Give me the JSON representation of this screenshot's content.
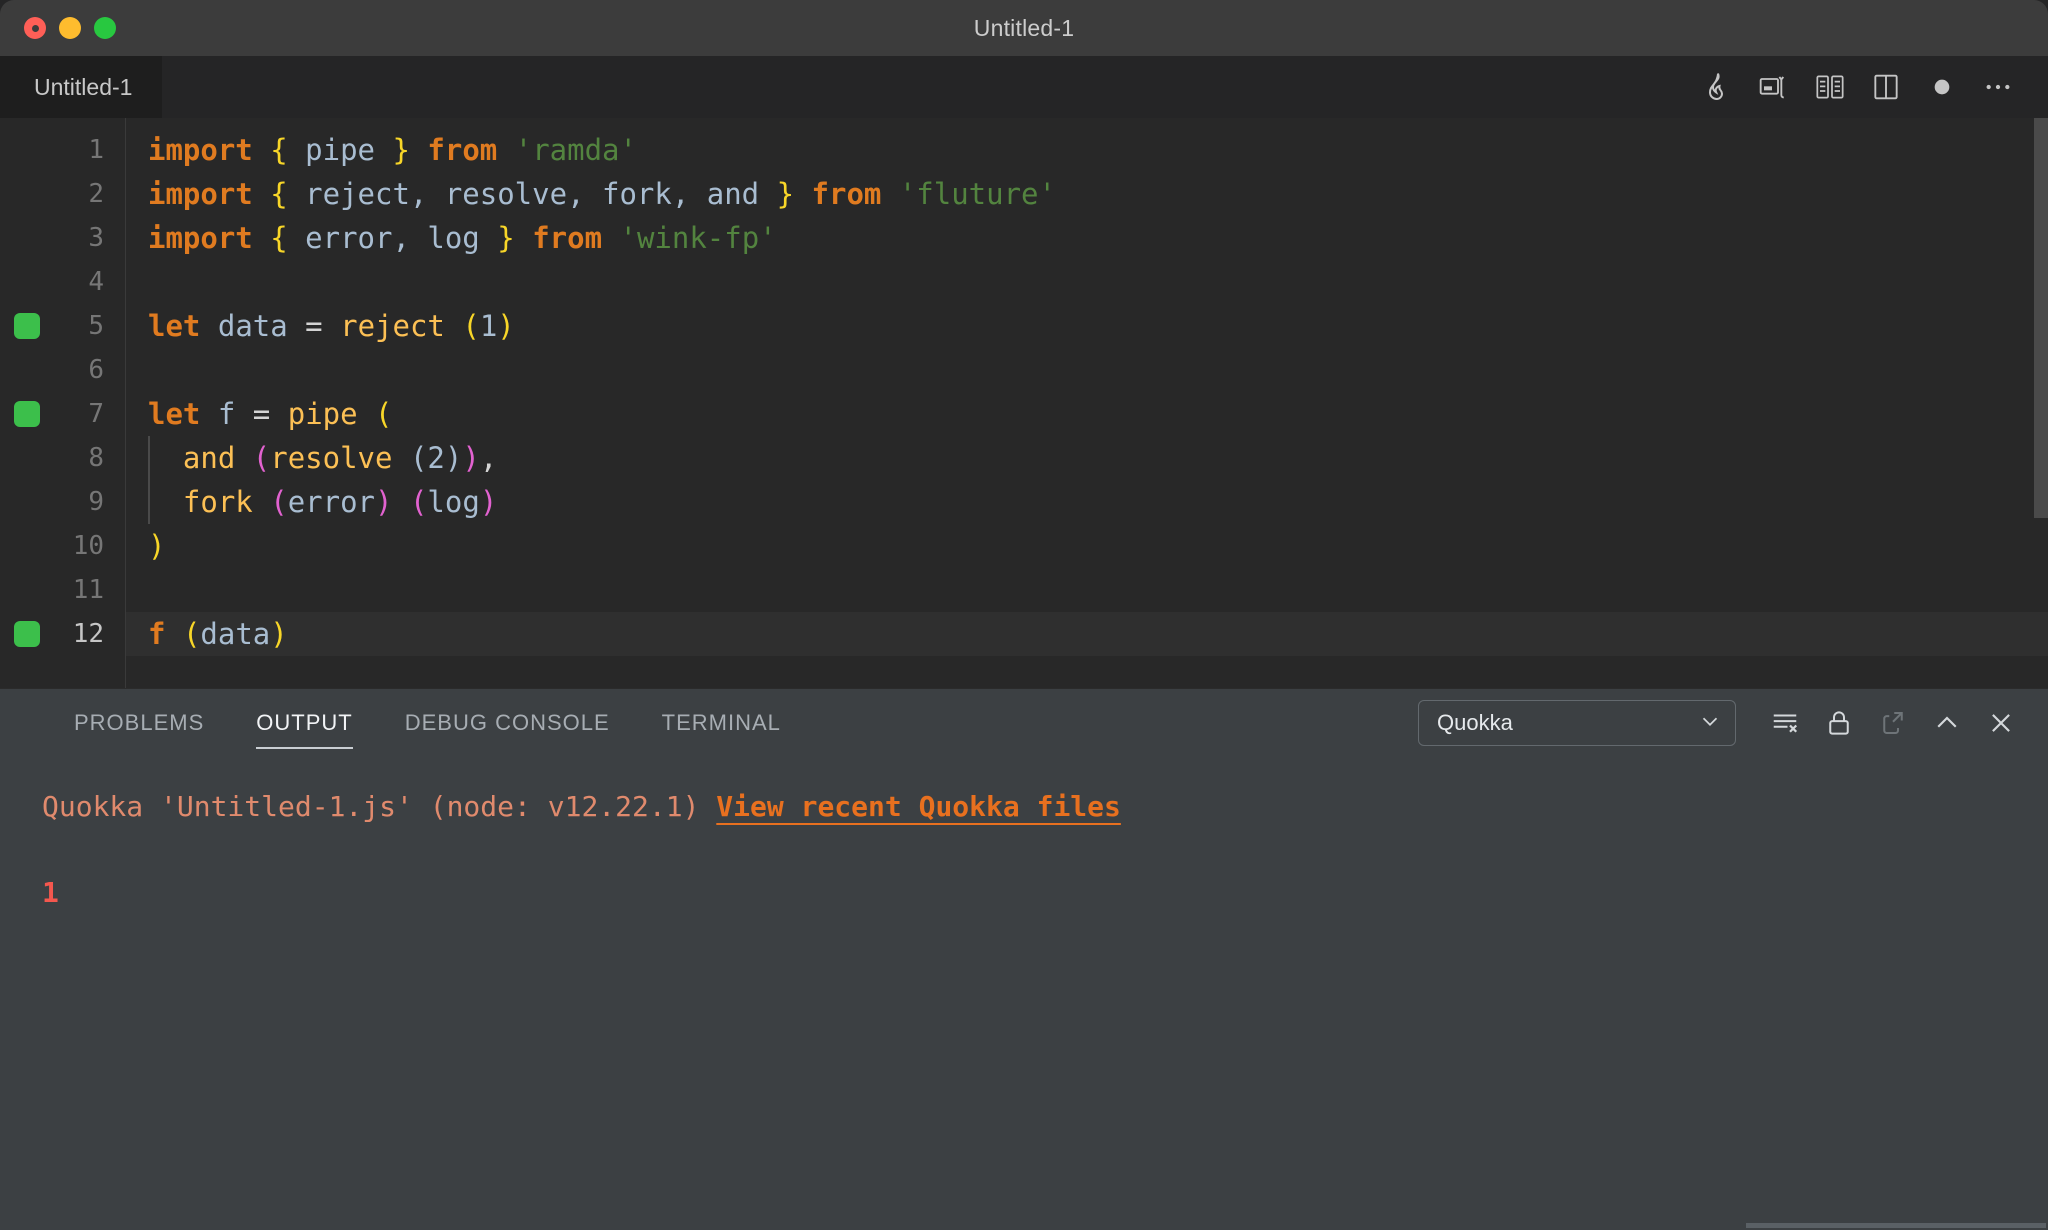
{
  "window": {
    "title": "Untitled-1",
    "traffic_lights": [
      "close",
      "minimize",
      "zoom"
    ]
  },
  "editor": {
    "tab": {
      "label": "Untitled-1"
    },
    "actions": [
      {
        "name": "quokka-flame-icon",
        "title": "Quokka"
      },
      {
        "name": "run-code-icon",
        "title": "Run Code"
      },
      {
        "name": "open-changes-icon",
        "title": "Open Changes"
      },
      {
        "name": "split-editor-icon",
        "title": "Split Editor Right"
      },
      {
        "name": "unsaved-dot-icon",
        "title": "Unsaved"
      },
      {
        "name": "more-actions-icon",
        "title": "More Actions..."
      }
    ],
    "lines": [
      {
        "num": "1",
        "marker": false,
        "active": false,
        "indent": false,
        "tokens": [
          {
            "t": "import",
            "c": "kw"
          },
          {
            "t": " ",
            "c": "op"
          },
          {
            "t": "{",
            "c": "b1"
          },
          {
            "t": " ",
            "c": "op"
          },
          {
            "t": "pipe",
            "c": "var"
          },
          {
            "t": " ",
            "c": "op"
          },
          {
            "t": "}",
            "c": "b1"
          },
          {
            "t": " ",
            "c": "op"
          },
          {
            "t": "from",
            "c": "kw"
          },
          {
            "t": " ",
            "c": "op"
          },
          {
            "t": "'ramda'",
            "c": "str"
          }
        ]
      },
      {
        "num": "2",
        "marker": false,
        "active": false,
        "indent": false,
        "tokens": [
          {
            "t": "import",
            "c": "kw"
          },
          {
            "t": " ",
            "c": "op"
          },
          {
            "t": "{",
            "c": "b1"
          },
          {
            "t": " ",
            "c": "op"
          },
          {
            "t": "reject, resolve, fork, and",
            "c": "var"
          },
          {
            "t": " ",
            "c": "op"
          },
          {
            "t": "}",
            "c": "b1"
          },
          {
            "t": " ",
            "c": "op"
          },
          {
            "t": "from",
            "c": "kw"
          },
          {
            "t": " ",
            "c": "op"
          },
          {
            "t": "'fluture'",
            "c": "str"
          }
        ]
      },
      {
        "num": "3",
        "marker": false,
        "active": false,
        "indent": false,
        "tokens": [
          {
            "t": "import",
            "c": "kw"
          },
          {
            "t": " ",
            "c": "op"
          },
          {
            "t": "{",
            "c": "b1"
          },
          {
            "t": " ",
            "c": "op"
          },
          {
            "t": "error, log",
            "c": "var"
          },
          {
            "t": " ",
            "c": "op"
          },
          {
            "t": "}",
            "c": "b1"
          },
          {
            "t": " ",
            "c": "op"
          },
          {
            "t": "from",
            "c": "kw"
          },
          {
            "t": " ",
            "c": "op"
          },
          {
            "t": "'wink-fp'",
            "c": "str"
          }
        ]
      },
      {
        "num": "4",
        "marker": false,
        "active": false,
        "indent": false,
        "tokens": []
      },
      {
        "num": "5",
        "marker": true,
        "active": false,
        "indent": false,
        "tokens": [
          {
            "t": "let",
            "c": "kw"
          },
          {
            "t": " ",
            "c": "op"
          },
          {
            "t": "data",
            "c": "var"
          },
          {
            "t": " ",
            "c": "op"
          },
          {
            "t": "=",
            "c": "op"
          },
          {
            "t": " ",
            "c": "op"
          },
          {
            "t": "reject",
            "c": "fn"
          },
          {
            "t": " ",
            "c": "op"
          },
          {
            "t": "(",
            "c": "b1"
          },
          {
            "t": "1",
            "c": "num"
          },
          {
            "t": ")",
            "c": "b1"
          }
        ]
      },
      {
        "num": "6",
        "marker": false,
        "active": false,
        "indent": false,
        "tokens": []
      },
      {
        "num": "7",
        "marker": true,
        "active": false,
        "indent": false,
        "tokens": [
          {
            "t": "let",
            "c": "kw"
          },
          {
            "t": " ",
            "c": "op"
          },
          {
            "t": "f",
            "c": "var"
          },
          {
            "t": " ",
            "c": "op"
          },
          {
            "t": "=",
            "c": "op"
          },
          {
            "t": " ",
            "c": "op"
          },
          {
            "t": "pipe",
            "c": "fn"
          },
          {
            "t": " ",
            "c": "op"
          },
          {
            "t": "(",
            "c": "b1"
          }
        ]
      },
      {
        "num": "8",
        "marker": false,
        "active": false,
        "indent": true,
        "tokens": [
          {
            "t": "  ",
            "c": "op"
          },
          {
            "t": "and",
            "c": "fn"
          },
          {
            "t": " ",
            "c": "op"
          },
          {
            "t": "(",
            "c": "b2"
          },
          {
            "t": "resolve",
            "c": "fn"
          },
          {
            "t": " ",
            "c": "op"
          },
          {
            "t": "(",
            "c": "b3"
          },
          {
            "t": "2",
            "c": "num"
          },
          {
            "t": ")",
            "c": "b3"
          },
          {
            "t": ")",
            "c": "b2"
          },
          {
            "t": ",",
            "c": "op"
          }
        ]
      },
      {
        "num": "9",
        "marker": false,
        "active": false,
        "indent": true,
        "tokens": [
          {
            "t": "  ",
            "c": "op"
          },
          {
            "t": "fork",
            "c": "fn"
          },
          {
            "t": " ",
            "c": "op"
          },
          {
            "t": "(",
            "c": "b2"
          },
          {
            "t": "error",
            "c": "var"
          },
          {
            "t": ")",
            "c": "b2"
          },
          {
            "t": " ",
            "c": "op"
          },
          {
            "t": "(",
            "c": "b2"
          },
          {
            "t": "log",
            "c": "var"
          },
          {
            "t": ")",
            "c": "b2"
          }
        ]
      },
      {
        "num": "10",
        "marker": false,
        "active": false,
        "indent": false,
        "tokens": [
          {
            "t": ")",
            "c": "b1"
          }
        ]
      },
      {
        "num": "11",
        "marker": false,
        "active": false,
        "indent": false,
        "tokens": []
      },
      {
        "num": "12",
        "marker": true,
        "active": true,
        "indent": false,
        "tokens": [
          {
            "t": "f",
            "c": "kw"
          },
          {
            "t": " ",
            "c": "op"
          },
          {
            "t": "(",
            "c": "b1"
          },
          {
            "t": "data",
            "c": "var"
          },
          {
            "t": ")",
            "c": "b1"
          }
        ]
      }
    ]
  },
  "panel": {
    "tabs": [
      {
        "label": "PROBLEMS",
        "active": false
      },
      {
        "label": "OUTPUT",
        "active": true
      },
      {
        "label": "DEBUG CONSOLE",
        "active": false
      },
      {
        "label": "TERMINAL",
        "active": false
      }
    ],
    "channel_select": {
      "value": "Quokka",
      "options": [
        "Quokka"
      ]
    },
    "actions": [
      {
        "name": "clear-output-icon",
        "title": "Clear Output"
      },
      {
        "name": "lock-scroll-icon",
        "title": "Turn Auto Scrolling Off"
      },
      {
        "name": "open-in-editor-icon",
        "title": "Open Output in Editor"
      },
      {
        "name": "maximize-panel-icon",
        "title": "Maximize Panel Size"
      },
      {
        "name": "close-panel-icon",
        "title": "Close Panel"
      }
    ],
    "output": {
      "header": "Quokka 'Untitled-1.js' (node: v12.22.1) ",
      "link": "View recent Quokka files",
      "result": "1"
    }
  },
  "colors": {
    "titlebar_bg": "#3c3c3c",
    "editor_bg": "#282828",
    "panel_bg": "#3c4043",
    "keyword": "#e07b20",
    "function": "#fcc055",
    "variable": "#a9bdd1",
    "string": "#53843f",
    "bracket_1": "#f8d628",
    "bracket_2": "#e262d0",
    "bracket_3": "#a9bdd1",
    "quokka_marker": "#3cbf4b",
    "output_header": "#e08a6d",
    "output_link": "#e8701f",
    "output_error": "#f4574e"
  }
}
